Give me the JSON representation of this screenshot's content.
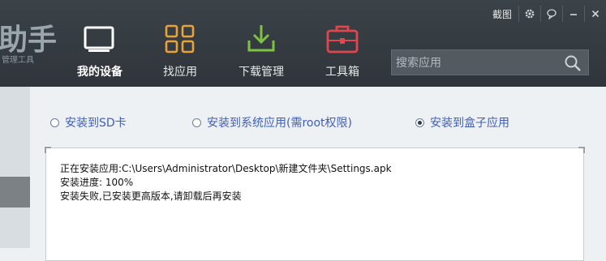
{
  "window": {
    "capture_label": "截图",
    "buttons": [
      "gear-icon",
      "feedback-icon",
      "minimize-icon",
      "close-icon"
    ]
  },
  "brand": {
    "name": "助手",
    "subtitle": "管理工具"
  },
  "nav": [
    {
      "label": "我的设备",
      "icon": "device-icon",
      "active": true
    },
    {
      "label": "找应用",
      "icon": "apps-grid-icon",
      "active": false
    },
    {
      "label": "下载管理",
      "icon": "download-icon",
      "active": false
    },
    {
      "label": "工具箱",
      "icon": "toolbox-icon",
      "active": false
    }
  ],
  "search": {
    "placeholder": "搜索应用",
    "icon": "search-icon"
  },
  "install_options": [
    {
      "label": "安装到SD卡",
      "checked": false
    },
    {
      "label": "安装到系统应用(需root权限)",
      "checked": false
    },
    {
      "label": "安装到盒子应用",
      "checked": true
    }
  ],
  "log": {
    "lines": [
      "正在安装应用:C:\\Users\\Administrator\\Desktop\\新建文件夹\\Settings.apk",
      "安装进度:  100%",
      "安装失败,已安装更高版本,请卸载后再安装"
    ]
  },
  "colors": {
    "header": "#2f353a",
    "option_text": "#3f5eb8",
    "download_icon": "#7fc142",
    "toolbox_icon": "#e0474c",
    "apps_icon": "#e8a23a"
  }
}
